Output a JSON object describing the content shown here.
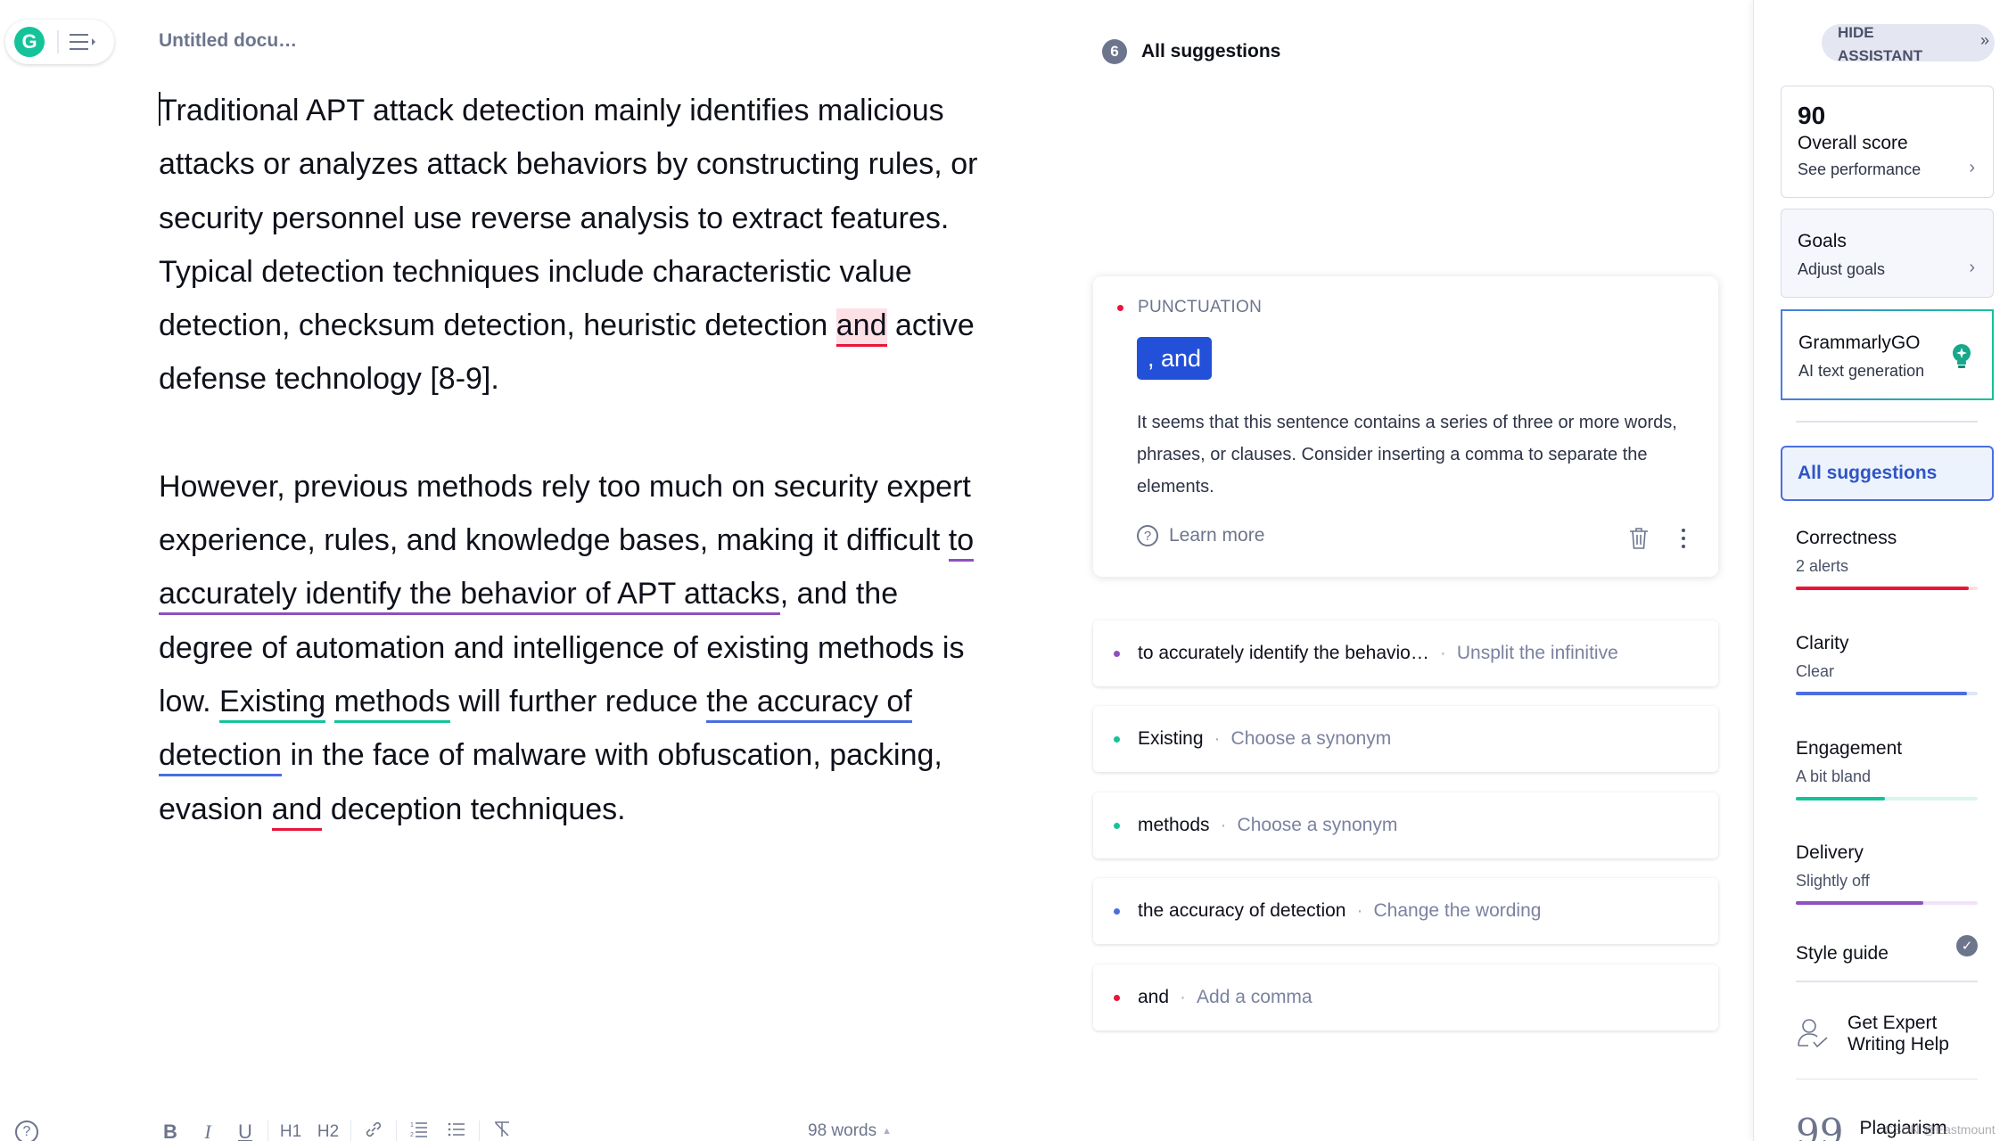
{
  "header": {
    "doc_title": "Untitled docu…",
    "logo_letter": "G"
  },
  "editor": {
    "paragraphs": [
      {
        "segments": [
          {
            "text": "Traditional APT attack detection mainly identifies malicious attacks or analyzes attack behaviors by constructing rules, or security personnel use reverse analysis to extract features. Typical detection techniques include characteristic value detection, checksum detection, heuristic detection "
          },
          {
            "text": "and",
            "mark": "red-active"
          },
          {
            "text": " active defense technology [8-9]."
          }
        ]
      },
      {
        "segments": [
          {
            "text": "However, previous methods rely too much on security expert experience, rules, and knowledge bases, making it difficult "
          },
          {
            "text": "to accurately identify the behavior of APT attacks",
            "mark": "purple"
          },
          {
            "text": ", and the degree of automation and intelligence of existing methods is low. "
          },
          {
            "text": "Existing",
            "mark": "green"
          },
          {
            "text": " "
          },
          {
            "text": "methods",
            "mark": "green"
          },
          {
            "text": " will further reduce "
          },
          {
            "text": "the accuracy of detection",
            "mark": "blue"
          },
          {
            "text": " in the face of malware with obfuscation, packing, evasion "
          },
          {
            "text": "and",
            "mark": "red"
          },
          {
            "text": " deception techniques."
          }
        ]
      }
    ]
  },
  "toolbar": {
    "help_icon": "?",
    "bold": "B",
    "italic": "I",
    "underline": "U",
    "h1": "H1",
    "h2": "H2",
    "link": "link-icon",
    "ordered_list": "ordered-list-icon",
    "unordered_list": "unordered-list-icon",
    "clear_format": "clear-format-icon",
    "word_count": "98 words",
    "word_count_toggle": "▲"
  },
  "suggestions": {
    "count": "6",
    "title": "All suggestions",
    "active_card": {
      "category": "PUNCTUATION",
      "category_color": "#e8153a",
      "replacement": ", and",
      "description": "It seems that this sentence contains a series of three or more words, phrases, or clauses. Consider inserting a comma to separate the elements.",
      "learn_more": "Learn more"
    },
    "items": [
      {
        "text": "to accurately identify the behavio…",
        "action": "Unsplit the infinitive",
        "color": "#8e4fbf"
      },
      {
        "text": "Existing",
        "action": "Choose a synonym",
        "color": "#15c39a"
      },
      {
        "text": "methods",
        "action": "Choose a synonym",
        "color": "#15c39a"
      },
      {
        "text": "the accuracy of detection",
        "action": "Change the wording",
        "color": "#4a6ee0"
      },
      {
        "text": "and",
        "action": "Add a comma",
        "color": "#e8153a"
      }
    ],
    "separator": "·"
  },
  "assistant": {
    "hide_label": "HIDE ASSISTANT",
    "hide_icon": "»",
    "score": {
      "value": "90",
      "label": "Overall score",
      "link": "See performance"
    },
    "goals": {
      "label": "Goals",
      "link": "Adjust goals"
    },
    "grammarly_go": {
      "label": "GrammarlyGO",
      "sub": "AI text generation"
    },
    "all_suggestions": "All suggestions",
    "metrics": [
      {
        "label": "Correctness",
        "status": "2 alerts",
        "progress": 0.95,
        "color": "#e8153a",
        "track": "#fde0e5"
      },
      {
        "label": "Clarity",
        "status": "Clear",
        "progress": 0.94,
        "color": "#4a6ee0",
        "track": "#dde6fb"
      },
      {
        "label": "Engagement",
        "status": "A bit bland",
        "progress": 0.49,
        "color": "#15c39a",
        "track": "#daf6ee"
      },
      {
        "label": "Delivery",
        "status": "Slightly off",
        "progress": 0.7,
        "color": "#8e4fbf",
        "track": "#f1e3fb"
      }
    ],
    "style_guide": "Style guide",
    "expert_help": "Get Expert Writing Help",
    "plagiarism": "Plagiarism"
  },
  "watermark": "CSDN @Eastmount"
}
